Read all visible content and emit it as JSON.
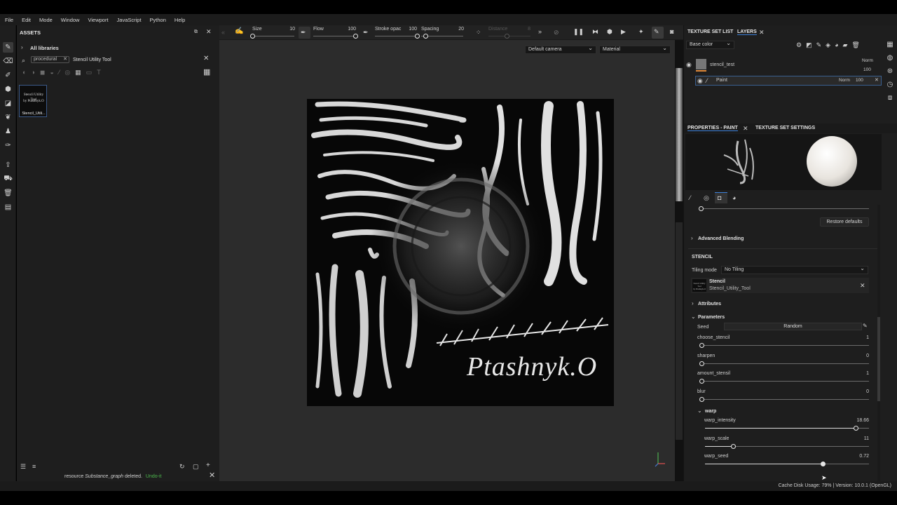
{
  "menu": [
    "File",
    "Edit",
    "Mode",
    "Window",
    "Viewport",
    "JavaScript",
    "Python",
    "Help"
  ],
  "assets": {
    "title": "ASSETS",
    "library": "All libraries",
    "filter_tag": "procedural",
    "search_value": "Stencil Utility Tool",
    "thumb_text_line1": "Stencil Utility Tool",
    "thumb_text_line2": "by Ptashnyk.O",
    "thumb_label": "Stencil_Utili..."
  },
  "toolbar": {
    "size_label": "Size",
    "size_value": "10",
    "size_level": 0.0,
    "flow_label": "Flow",
    "flow_value": "100",
    "flow_level": 1.0,
    "opacity_label": "Stroke opac",
    "opacity_value": "100",
    "opacity_level": 1.0,
    "spacing_label": "Spacing",
    "spacing_value": "20",
    "spacing_level": 0.1,
    "distance_label": "Distance",
    "distance_value": "8"
  },
  "viewport": {
    "camera": "Default camera",
    "mode": "Material",
    "canvas_signature": "Ptashnyk.O"
  },
  "layers": {
    "tab_list": "TEXTURE SET LIST",
    "tab_layers": "LAYERS",
    "channel": "Base color",
    "layer_name": "stencil_test",
    "layer_blend": "Norm",
    "layer_opacity": "100",
    "sublayer_name": "Paint",
    "sublayer_blend": "Norm",
    "sublayer_opacity": "100"
  },
  "properties": {
    "tab_paint": "PROPERTIES - PAINT",
    "tab_settings": "TEXTURE SET SETTINGS",
    "restore_label": "Restore defaults",
    "advanced_blending": "Advanced Blending",
    "stencil_header": "STENCIL",
    "tiling_label": "Tiling mode",
    "tiling_value": "No Tiling",
    "stencil_name": "Stencil",
    "stencil_resource": "Stencil_Utility_Tool",
    "attributes": "Attributes",
    "parameters": "Parameters",
    "seed_label": "Seed",
    "seed_value": "Random",
    "params": [
      {
        "name": "choose_stencil",
        "value": "1",
        "level": 0.0
      },
      {
        "name": "sharpen",
        "value": "0",
        "level": 0.0
      },
      {
        "name": "amount_stensil",
        "value": "1",
        "level": 0.0
      },
      {
        "name": "blur",
        "value": "0",
        "level": 0.0
      }
    ],
    "warp_group": "warp",
    "warp_params": [
      {
        "name": "warp_intensity",
        "value": "18.66",
        "level": 0.92
      },
      {
        "name": "warp_scale",
        "value": "11",
        "level": 0.17
      },
      {
        "name": "warp_seed",
        "value": "0.72",
        "level": 0.72
      }
    ]
  },
  "log": {
    "message_prefix": "resource",
    "message_resource": "Substance_graph",
    "message_suffix": "deleted.",
    "undo": "Undo-it"
  },
  "status": {
    "cache_label": "Cache Disk Usage:",
    "cache_value": "79%",
    "version": "| Version: 10.0.1 (OpenGL)"
  }
}
